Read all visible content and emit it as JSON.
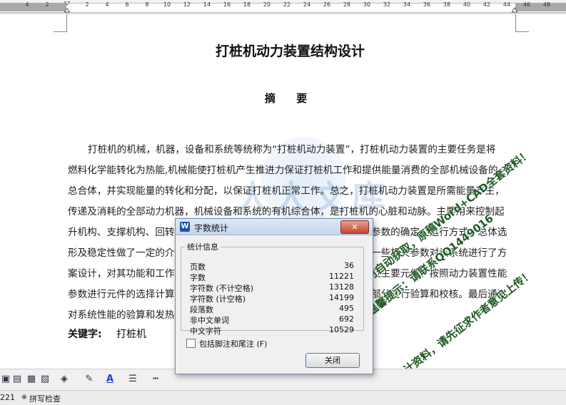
{
  "ruler": {
    "ticks": [
      "4",
      "2",
      "2",
      "4",
      "6",
      "8",
      "10",
      "12",
      "14",
      "16",
      "18",
      "20",
      "22",
      "24",
      "26",
      "28",
      "30",
      "32",
      "34",
      "36",
      "38",
      "40",
      "42",
      "44",
      "46",
      "48"
    ]
  },
  "document": {
    "title": "打桩机动力装置结构设计",
    "abstract_heading": "摘  要",
    "paragraph_lines": [
      "打桩机的机械，机器，设备和系统等统称为“打桩机动力装置”，打桩机动力装置的主要任务是将",
      "燃料化学能转化为热能,机械能使打桩机产生推进力保证打桩机工作和提供能量消费的全部机械设备的",
      "总合体，并实现能量的转化和分配，以保证打桩机正常工作。总之，打桩机动力装置是所需能量产生，",
      "传递及消耗的全部动力机器，机械设备和系统的有机综合体，是打桩机的心脏和动脉。主要用来控制起",
      "升机构、支撑机构、回转",
      "形及稳定性做了一定的介",
      "案设计，对其功能和工作",
      "参数进行元件的选择计算",
      "对系统性能的验算和发热"
    ],
    "paragraph_line_tails": [
      "",
      "",
      "",
      "",
      "参数的确定，运行方式、总体选",
      "一些相关参数对该系统进行了方",
      "及主要元件。按照动力装置性能",
      "部分进行验算和校核。最后通过",
      ""
    ],
    "keywords_label": "关键字:",
    "keywords_value": "打桩机"
  },
  "watermark": {
    "logo": "人人文库",
    "url": "renrendoc.com",
    "notice_1": "原稿可自动获取，原稿Word+CAD全套资料！",
    "notice_2": "温馨提示：请联系QQ1449016",
    "notice_3": "优秀设计资料，请先征求作者意见上传！"
  },
  "dialog": {
    "title": "字数统计",
    "close_glyph": "✕",
    "group_label": "统计信息",
    "stats": [
      {
        "label": "页数",
        "value": "36"
      },
      {
        "label": "字数",
        "value": "11221"
      },
      {
        "label": "字符数 (不计空格)",
        "value": "13128"
      },
      {
        "label": "字符数 (计空格)",
        "value": "14199"
      },
      {
        "label": "段落数",
        "value": "495"
      },
      {
        "label": "非中文单词",
        "value": "692"
      },
      {
        "label": "中文字符",
        "value": "10529"
      }
    ],
    "checkbox_label": "包括脚注和尾注 (F)",
    "checkbox_checked": false,
    "close_button": "关闭",
    "app_icon_letter": "W"
  },
  "status_bar": {
    "word_count": "221",
    "spell_check": "拼写检查"
  },
  "toolbar": {
    "font_color_glyph": "A"
  },
  "colors": {
    "accent": "#3a7bd5",
    "font_color_bar": "#1a3fd0",
    "watermark_text": "#1d5a22"
  }
}
